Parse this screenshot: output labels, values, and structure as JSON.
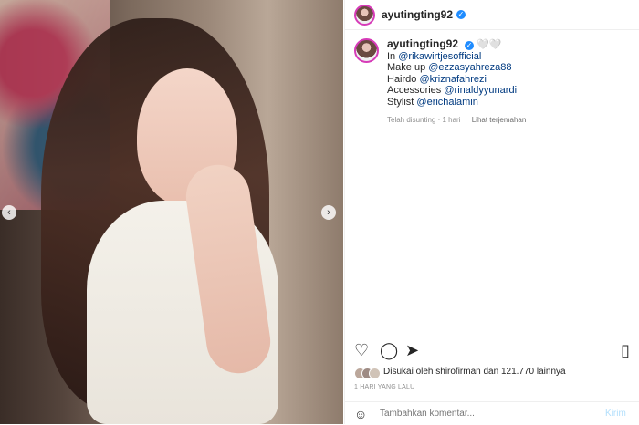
{
  "post": {
    "username": "ayutingting92",
    "verified_icon": "verified-icon",
    "caption_lines": [
      {
        "prefix": "In ",
        "mention": "@rikawirtjesofficial"
      },
      {
        "prefix": "Make up ",
        "mention": "@ezzasyahreza88"
      },
      {
        "prefix": "Hairdo ",
        "mention": "@kriznafahrezi"
      },
      {
        "prefix": "Accessories ",
        "mention": "@rinaldyyunardi"
      },
      {
        "prefix": "Stylist ",
        "mention": "@erichalamin"
      }
    ],
    "caption_emoji": "🤍🤍",
    "edited_label": "Telah disunting · 1 hari",
    "translate_label": "Lihat terjemahan",
    "likes_text": "Disukai oleh shirofirman dan 121.770 lainnya",
    "time_ago": "1 HARI YANG LALU",
    "comment_placeholder": "Tambahkan komentar...",
    "send_label": "Kirim"
  },
  "icons": {
    "nav_left": "chevron-left-icon",
    "nav_right": "chevron-right-icon",
    "like": "heart-icon",
    "comment": "comment-icon",
    "share": "send-icon",
    "save": "bookmark-icon",
    "emoji": "emoji-icon"
  }
}
